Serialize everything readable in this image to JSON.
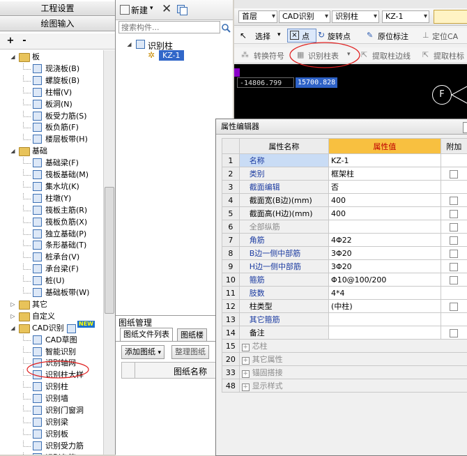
{
  "left_panel": {
    "title1": "工程设置",
    "title2": "绘图输入",
    "toolbar": {
      "add": "+",
      "remove": "-"
    },
    "tree": [
      {
        "label": "板",
        "level": 0,
        "type": "folder",
        "expanded": true
      },
      {
        "label": "现浇板(B)",
        "level": 1
      },
      {
        "label": "螺旋板(B)",
        "level": 1
      },
      {
        "label": "柱帽(V)",
        "level": 1
      },
      {
        "label": "板洞(N)",
        "level": 1
      },
      {
        "label": "板受力筋(S)",
        "level": 1
      },
      {
        "label": "板负筋(F)",
        "level": 1
      },
      {
        "label": "楼层板带(H)",
        "level": 1
      },
      {
        "label": "基础",
        "level": 0,
        "type": "folder",
        "expanded": true
      },
      {
        "label": "基础梁(F)",
        "level": 1
      },
      {
        "label": "筏板基础(M)",
        "level": 1
      },
      {
        "label": "集水坑(K)",
        "level": 1
      },
      {
        "label": "柱墩(Y)",
        "level": 1
      },
      {
        "label": "筏板主筋(R)",
        "level": 1
      },
      {
        "label": "筏板负筋(X)",
        "level": 1
      },
      {
        "label": "独立基础(P)",
        "level": 1
      },
      {
        "label": "条形基础(T)",
        "level": 1
      },
      {
        "label": "桩承台(V)",
        "level": 1
      },
      {
        "label": "承台梁(F)",
        "level": 1
      },
      {
        "label": "桩(U)",
        "level": 1
      },
      {
        "label": "基础板带(W)",
        "level": 1
      },
      {
        "label": "其它",
        "level": 0,
        "type": "folder",
        "expanded": false
      },
      {
        "label": "自定义",
        "level": 0,
        "type": "folder",
        "expanded": false
      },
      {
        "label": "CAD识别",
        "level": 0,
        "type": "folder",
        "expanded": true,
        "badge": "NEW"
      },
      {
        "label": "CAD草图",
        "level": 1
      },
      {
        "label": "智能识别",
        "level": 1
      },
      {
        "label": "识别轴网",
        "level": 1
      },
      {
        "label": "识别柱大样",
        "level": 1
      },
      {
        "label": "识别柱",
        "level": 1,
        "highlighted": true
      },
      {
        "label": "识别墙",
        "level": 1
      },
      {
        "label": "识别门窗洞",
        "level": 1
      },
      {
        "label": "识别梁",
        "level": 1
      },
      {
        "label": "识别板",
        "level": 1
      },
      {
        "label": "识别受力筋",
        "level": 1
      },
      {
        "label": "识别负筋",
        "level": 1
      },
      {
        "label": "识别独立基础",
        "level": 1
      }
    ]
  },
  "middle_panel": {
    "new_label": "新建",
    "delete_icon": "close-icon",
    "search_placeholder": "搜索构件...",
    "tree_root": "识别柱",
    "tree_child": "KZ-1",
    "drawing_mgr": {
      "title": "图纸管理",
      "pin": "⊥",
      "tab1": "图纸文件列表",
      "tab2": "图纸楼",
      "add_btn": "添加图纸",
      "arrange_btn": "整理图纸",
      "col_name": "图纸名称"
    }
  },
  "right_toolbar": {
    "row1": {
      "floor": "首层",
      "cad": "CAD识别",
      "element": "识别柱",
      "comp": "KZ-1"
    },
    "row2": {
      "select": "选择",
      "point": "点",
      "rotate_point": "旋转点",
      "origin_mark": "原位标注",
      "locate": "定位CA"
    },
    "row3": {
      "convert_symbol": "转换符号",
      "recognize_table": "识别柱表",
      "extract_edge": "提取柱边线",
      "extract_mark": "提取柱标"
    }
  },
  "canvas": {
    "coord_x": "-14806.799",
    "coord_y": "15700.828",
    "axis_label": "F"
  },
  "property_dialog": {
    "title": "属性编辑器",
    "headers": {
      "name": "属性名称",
      "value": "属性值",
      "add": "附加"
    },
    "rows": [
      {
        "num": "1",
        "name": "名称",
        "value": "KZ-1",
        "style": "blue",
        "check": false,
        "selected": true
      },
      {
        "num": "2",
        "name": "类别",
        "value": "框架柱",
        "style": "blue",
        "check": true
      },
      {
        "num": "3",
        "name": "截面编辑",
        "value": "否",
        "style": "blue",
        "check": false
      },
      {
        "num": "4",
        "name": "截面宽(B边)(mm)",
        "value": "400",
        "style": "normal",
        "check": true
      },
      {
        "num": "5",
        "name": "截面高(H边)(mm)",
        "value": "400",
        "style": "normal",
        "check": true
      },
      {
        "num": "6",
        "name": "全部纵筋",
        "value": "",
        "style": "gray",
        "check": true
      },
      {
        "num": "7",
        "name": "角筋",
        "value": "4Φ22",
        "style": "blue",
        "check": true
      },
      {
        "num": "8",
        "name": "B边一侧中部筋",
        "value": "3Φ20",
        "style": "blue",
        "check": true
      },
      {
        "num": "9",
        "name": "H边一侧中部筋",
        "value": "3Φ20",
        "style": "blue",
        "check": true
      },
      {
        "num": "10",
        "name": "箍筋",
        "value": "Φ10@100/200",
        "style": "blue",
        "check": true
      },
      {
        "num": "11",
        "name": "肢数",
        "value": "4*4",
        "style": "blue",
        "check": false
      },
      {
        "num": "12",
        "name": "柱类型",
        "value": "(中柱)",
        "style": "normal",
        "check": true
      },
      {
        "num": "13",
        "name": "其它箍筋",
        "value": "",
        "style": "blue",
        "check": false
      },
      {
        "num": "14",
        "name": "备注",
        "value": "",
        "style": "normal",
        "check": true
      },
      {
        "num": "15",
        "name": "芯柱",
        "value": "",
        "style": "group",
        "check": false
      },
      {
        "num": "20",
        "name": "其它属性",
        "value": "",
        "style": "group",
        "check": false
      },
      {
        "num": "33",
        "name": "锚固搭接",
        "value": "",
        "style": "group",
        "check": false
      },
      {
        "num": "48",
        "name": "显示样式",
        "value": "",
        "style": "group",
        "check": false
      }
    ]
  }
}
